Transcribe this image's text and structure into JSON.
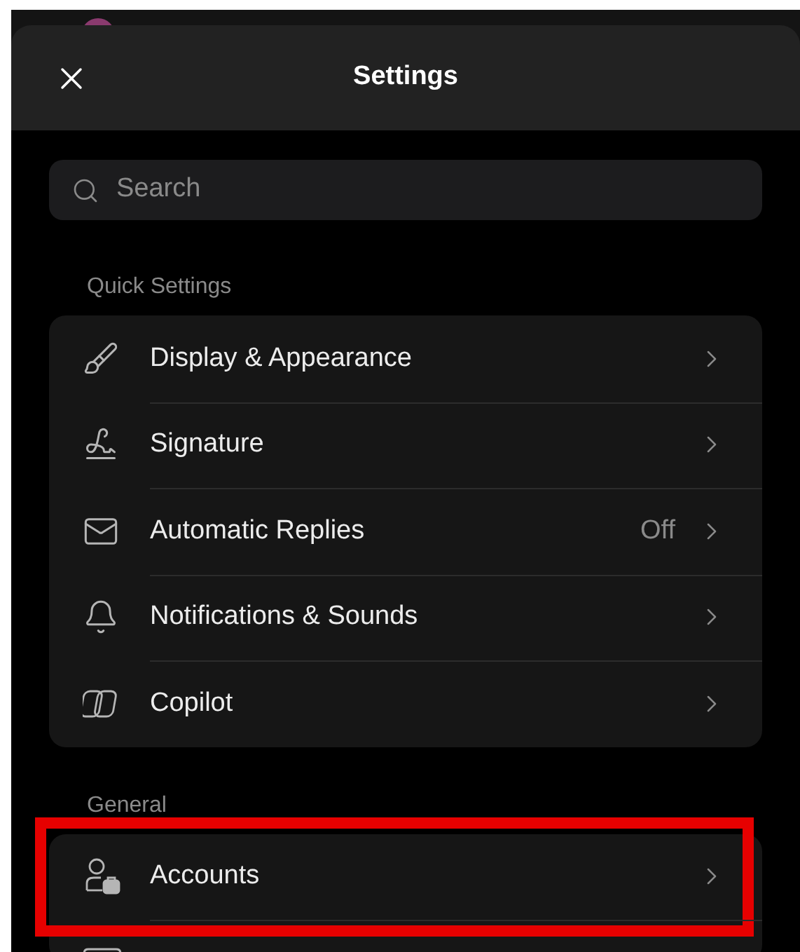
{
  "header": {
    "title": "Settings"
  },
  "search": {
    "placeholder": "Search"
  },
  "sections": [
    {
      "title": "Quick Settings",
      "items": [
        {
          "kind": "display",
          "label": "Display & Appearance",
          "highlighted": false
        },
        {
          "kind": "signature",
          "label": "Signature",
          "highlighted": false
        },
        {
          "kind": "replies",
          "label": "Automatic Replies",
          "value": "Off",
          "highlighted": false
        },
        {
          "kind": "notifications",
          "label": "Notifications & Sounds",
          "highlighted": false
        },
        {
          "kind": "copilot",
          "label": "Copilot",
          "highlighted": false
        }
      ]
    },
    {
      "title": "General",
      "items": [
        {
          "kind": "accounts",
          "label": "Accounts",
          "highlighted": true
        },
        {
          "kind": "partial"
        }
      ]
    }
  ]
}
